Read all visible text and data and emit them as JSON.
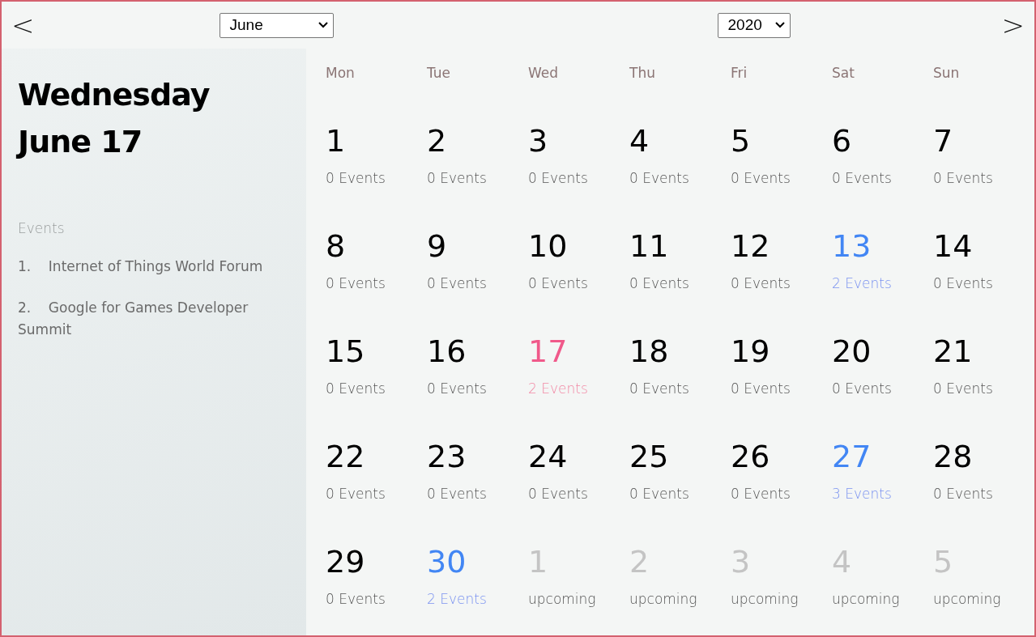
{
  "nav": {
    "previous": "<",
    "next": ">",
    "month": "June",
    "year": "2020"
  },
  "detail": {
    "weekday": "Wednesday",
    "date": "June 17",
    "events_heading": "Events",
    "events": [
      {
        "number": "1.",
        "title": "Internet of Things World Forum"
      },
      {
        "number": "2.",
        "title": "Google for Games Developer Summit"
      }
    ]
  },
  "weekdays": [
    "Mon",
    "Tue",
    "Wed",
    "Thu",
    "Fri",
    "Sat",
    "Sun"
  ],
  "days": [
    {
      "number": "1",
      "caption": "0 Events",
      "kind": "plain"
    },
    {
      "number": "2",
      "caption": "0 Events",
      "kind": "plain"
    },
    {
      "number": "3",
      "caption": "0 Events",
      "kind": "plain"
    },
    {
      "number": "4",
      "caption": "0 Events",
      "kind": "plain"
    },
    {
      "number": "5",
      "caption": "0 Events",
      "kind": "plain"
    },
    {
      "number": "6",
      "caption": "0 Events",
      "kind": "plain"
    },
    {
      "number": "7",
      "caption": "0 Events",
      "kind": "plain"
    },
    {
      "number": "8",
      "caption": "0 Events",
      "kind": "plain"
    },
    {
      "number": "9",
      "caption": "0 Events",
      "kind": "plain"
    },
    {
      "number": "10",
      "caption": "0 Events",
      "kind": "plain"
    },
    {
      "number": "11",
      "caption": "0 Events",
      "kind": "plain"
    },
    {
      "number": "12",
      "caption": "0 Events",
      "kind": "plain"
    },
    {
      "number": "13",
      "caption": "2 Events",
      "kind": "events"
    },
    {
      "number": "14",
      "caption": "0 Events",
      "kind": "plain"
    },
    {
      "number": "15",
      "caption": "0 Events",
      "kind": "plain"
    },
    {
      "number": "16",
      "caption": "0 Events",
      "kind": "plain"
    },
    {
      "number": "17",
      "caption": "2 Events",
      "kind": "selected"
    },
    {
      "number": "18",
      "caption": "0 Events",
      "kind": "plain"
    },
    {
      "number": "19",
      "caption": "0 Events",
      "kind": "plain"
    },
    {
      "number": "20",
      "caption": "0 Events",
      "kind": "plain"
    },
    {
      "number": "21",
      "caption": "0 Events",
      "kind": "plain"
    },
    {
      "number": "22",
      "caption": "0 Events",
      "kind": "plain"
    },
    {
      "number": "23",
      "caption": "0 Events",
      "kind": "plain"
    },
    {
      "number": "24",
      "caption": "0 Events",
      "kind": "plain"
    },
    {
      "number": "25",
      "caption": "0 Events",
      "kind": "plain"
    },
    {
      "number": "26",
      "caption": "0 Events",
      "kind": "plain"
    },
    {
      "number": "27",
      "caption": "3 Events",
      "kind": "events"
    },
    {
      "number": "28",
      "caption": "0 Events",
      "kind": "plain"
    },
    {
      "number": "29",
      "caption": "0 Events",
      "kind": "plain"
    },
    {
      "number": "30",
      "caption": "2 Events",
      "kind": "events"
    },
    {
      "number": "1",
      "caption": "upcoming",
      "kind": "upcoming"
    },
    {
      "number": "2",
      "caption": "upcoming",
      "kind": "upcoming"
    },
    {
      "number": "3",
      "caption": "upcoming",
      "kind": "upcoming"
    },
    {
      "number": "4",
      "caption": "upcoming",
      "kind": "upcoming"
    },
    {
      "number": "5",
      "caption": "upcoming",
      "kind": "upcoming"
    }
  ]
}
